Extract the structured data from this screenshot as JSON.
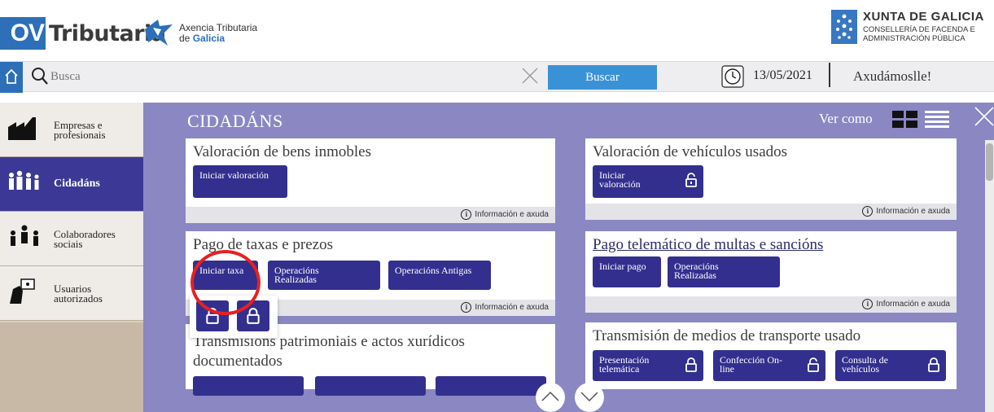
{
  "header": {
    "ov_logo": "OV",
    "ov_title": "Tributaria",
    "agency_line1": "Axencia Tributaria",
    "agency_line2_prefix": "de ",
    "agency_line2_brand": "Galicia",
    "xunta_title": "XUNTA DE GALICIA",
    "xunta_sub1": "CONSELLERÍA DE FACENDA E",
    "xunta_sub2": "ADMINISTRACIÓN PÚBLICA"
  },
  "search": {
    "placeholder": "Busca",
    "button_label": "Buscar",
    "date": "13/05/2021",
    "help_label": "Axudámoslle!"
  },
  "nav": {
    "items": [
      {
        "line1": "Empresas e",
        "line2": "profesionais",
        "icon": "factory-icon",
        "active": false
      },
      {
        "line1": "Cidadáns",
        "line2": "",
        "icon": "people-icon",
        "active": true
      },
      {
        "line1": "Colaboradores",
        "line2": "sociais",
        "icon": "collaborators-icon",
        "active": false
      },
      {
        "line1": "Usuarios",
        "line2": "autorizados",
        "icon": "authorized-user-icon",
        "active": false
      }
    ]
  },
  "main": {
    "title": "CIDADÁNS",
    "view_as": "Ver como",
    "info_label": "Información e axuda",
    "cards": [
      {
        "title": "Valoración de bens inmobles",
        "buttons": [
          "Iniciar valoración"
        ]
      },
      {
        "title": "Valoración de vehículos usados",
        "buttons": [
          {
            "line1": "Iniciar",
            "line2": "valoración"
          }
        ]
      },
      {
        "title": "Pago de taxas e prezos",
        "buttons": [
          "Iniciar taxa",
          {
            "line1": "Operacións",
            "line2": "Realizadas"
          },
          "Operacións Antigas"
        ]
      },
      {
        "title": "Pago telemático de multas e sancións",
        "buttons": [
          "Iniciar pago",
          {
            "line1": "Operacións",
            "line2": "Realizadas"
          }
        ]
      },
      {
        "title_line1": "Transmisións patrimoniais e actos xurídicos",
        "title_line2": "documentados"
      },
      {
        "title": "Transmisión de medios de transporte usado",
        "buttons": [
          {
            "line1": "Presentación",
            "line2": "telemática"
          },
          {
            "line1": "Confección On-",
            "line2": "line"
          },
          {
            "line1": "Consulta de",
            "line2": "vehículos"
          }
        ]
      }
    ]
  },
  "colors": {
    "brand_blue": "#2d6fb8",
    "panel_purple": "#8a87c3",
    "button_indigo": "#332f8e",
    "search_button": "#3a92d6",
    "annotation_red": "#e82020"
  }
}
